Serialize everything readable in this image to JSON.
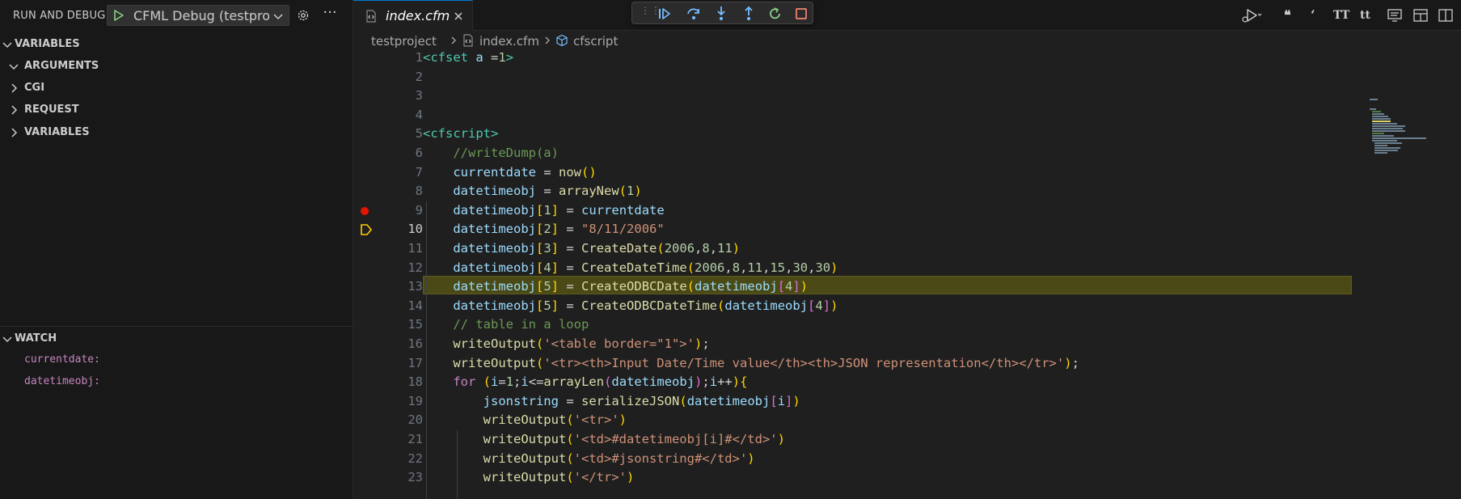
{
  "sidebar": {
    "title": "RUN AND DEBUG",
    "config": "CFML Debug (testproject)",
    "variables_section": "VARIABLES",
    "scopes": [
      "ARGUMENTS",
      "CGI",
      "REQUEST",
      "VARIABLES"
    ],
    "watch_section": "WATCH",
    "watch_expressions": [
      "currentdate:",
      "datetimeobj:"
    ]
  },
  "editor": {
    "tab_label": "index.cfm",
    "breadcrumb": [
      "testproject",
      "index.cfm",
      "cfscript"
    ],
    "current_line": 10,
    "breakpoint_line": 9,
    "debug_toolbar": [
      "continue-icon",
      "step-over-icon",
      "step-into-icon",
      "step-out-icon",
      "restart-icon",
      "stop-icon"
    ],
    "right_actions": [
      "run-debug-icon",
      "ts-quote-double",
      "ts-quote-single",
      "TT",
      "tt",
      "screen-icon",
      "layout-icon",
      "split-editor-icon"
    ],
    "lines": [
      {
        "n": "1",
        "text": "<cfset a =1>"
      },
      {
        "n": "2",
        "text": ""
      },
      {
        "n": "3",
        "text": ""
      },
      {
        "n": "4",
        "text": ""
      },
      {
        "n": "5",
        "text": "<cfscript>"
      },
      {
        "n": "6",
        "text": "    //writeDump(a)"
      },
      {
        "n": "7",
        "text": "    currentdate = now()"
      },
      {
        "n": "8",
        "text": "    datetimeobj = arrayNew(1)"
      },
      {
        "n": "9",
        "text": "    datetimeobj[1] = currentdate"
      },
      {
        "n": "10",
        "text": "    datetimeobj[2] = \"8/11/2006\""
      },
      {
        "n": "11",
        "text": "    datetimeobj[3] = CreateDate(2006,8,11)"
      },
      {
        "n": "12",
        "text": "    datetimeobj[4] = CreateDateTime(2006,8,11,15,30,30)"
      },
      {
        "n": "13",
        "text": "    datetimeobj[5] = CreateODBCDate(datetimeobj[4])"
      },
      {
        "n": "14",
        "text": "    datetimeobj[5] = CreateODBCDateTime(datetimeobj[4])"
      },
      {
        "n": "15",
        "text": "    // table in a loop"
      },
      {
        "n": "16",
        "text": "    writeOutput('<table border=\"1\">');"
      },
      {
        "n": "17",
        "text": "    writeOutput('<tr><th>Input Date/Time value</th><th>JSON representation</th></tr>');"
      },
      {
        "n": "18",
        "text": "    for (i=1;i<=arrayLen(datetimeobj);i++){"
      },
      {
        "n": "19",
        "text": "        jsonstring = serializeJSON(datetimeobj[i])"
      },
      {
        "n": "20",
        "text": "        writeOutput('<tr>')"
      },
      {
        "n": "21",
        "text": "        writeOutput('<td>#datetimeobj[i]#</td>')"
      },
      {
        "n": "22",
        "text": "        writeOutput('<td>#jsonstring#</td>')"
      },
      {
        "n": "23",
        "text": "        writeOutput('</tr>')"
      }
    ]
  }
}
